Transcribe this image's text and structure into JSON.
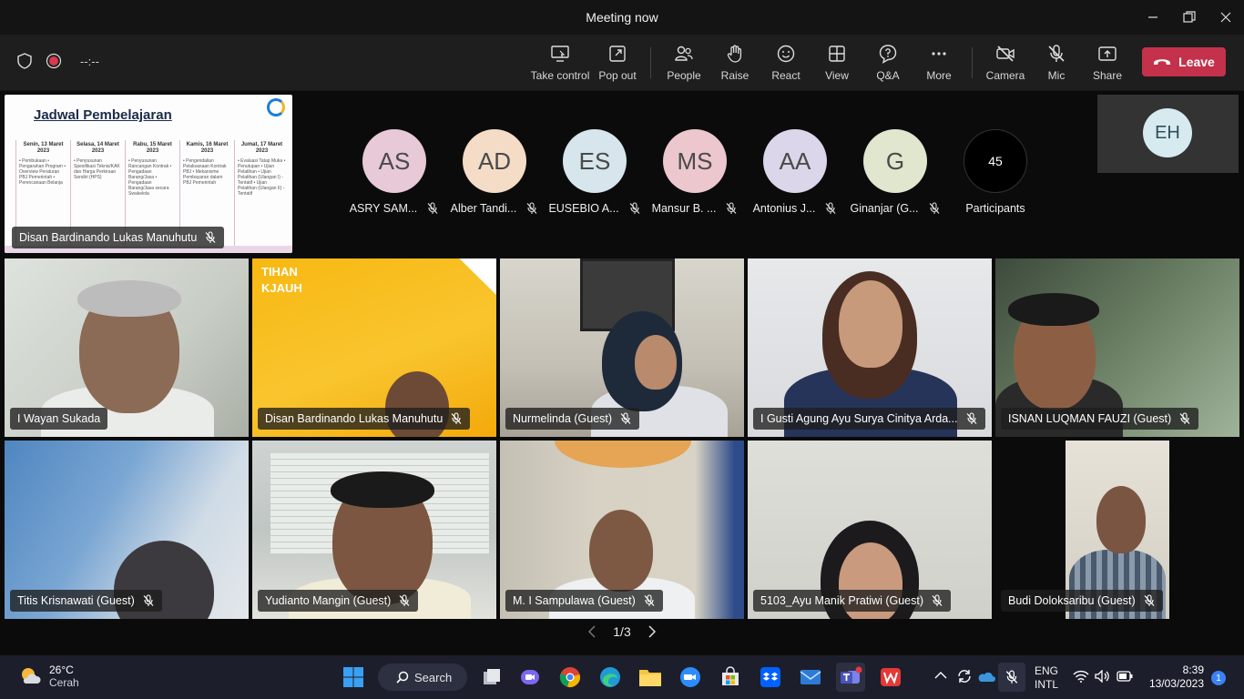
{
  "window": {
    "title": "Meeting now"
  },
  "toolbar": {
    "timer": "--:--",
    "buttons": {
      "take_control": "Take control",
      "pop_out": "Pop out",
      "people": "People",
      "raise": "Raise",
      "react": "React",
      "view": "View",
      "qa": "Q&A",
      "more": "More",
      "camera": "Camera",
      "mic": "Mic",
      "share": "Share"
    },
    "leave": "Leave",
    "leave_color": "#c4314b"
  },
  "shared_content": {
    "slide_title": "Jadwal Pembelajaran",
    "columns": [
      {
        "header": "Senin, 13 Maret 2023",
        "body": "• Pembukaan • Pengarahan Program • Overview Peraturan PBJ Pemerintah • Perencanaan Belanja"
      },
      {
        "header": "Selasa, 14 Maret 2023",
        "body": "• Penyusunan Spesifikasi Teknis/KAK dan Harga Perkiraan Sendiri (HPS)"
      },
      {
        "header": "Rabu, 15 Maret 2023",
        "body": "• Penyusunan Rancangan Kontrak • Pengadaan Barang/Jasa • Pengadaan Barang/Jasa secara Swakelola"
      },
      {
        "header": "Kamis, 16 Maret 2023",
        "body": "• Pengendalian Pelaksanaan Kontrak PBJ • Mekanisme Pembayaran dalam PBJ Pemerintah"
      },
      {
        "header": "Jumat, 17 Maret 2023",
        "body": "• Evaluasi Tatap Muka • Penutupan • Ujian Pelatihan • Ujian Pelatihan (Ulangan I) - Tentatif • Ujian Pelatihan (Ulangan II) - Tentatif"
      }
    ],
    "presenter": "Disan Bardinando Lukas Manuhutu"
  },
  "audio_participants": [
    {
      "initials": "AS",
      "name": "ASRY SAM...",
      "color": "#e8c9d8"
    },
    {
      "initials": "AD",
      "name": "Alber Tandi...",
      "color": "#f5dcc6"
    },
    {
      "initials": "ES",
      "name": "EUSEBIO A...",
      "color": "#d6e6ec"
    },
    {
      "initials": "MS",
      "name": "Mansur B. ...",
      "color": "#ecc7cd"
    },
    {
      "initials": "AA",
      "name": "Antonius J...",
      "color": "#dcd6ea"
    },
    {
      "initials": "G",
      "name": "Ginanjar (G...",
      "color": "#e1e6cf"
    }
  ],
  "participants": {
    "count": "45",
    "label": "Participants"
  },
  "self_view": {
    "initials": "EH"
  },
  "video_tiles": [
    {
      "name": "I Wayan Sukada",
      "muted": false
    },
    {
      "name": "Disan Bardinando Lukas Manuhutu",
      "muted": true
    },
    {
      "name": "Nurmelinda (Guest)",
      "muted": true
    },
    {
      "name": "I Gusti Agung Ayu Surya Cinitya Arda...",
      "muted": true
    },
    {
      "name": "ISNAN LUQMAN FAUZI (Guest)",
      "muted": true
    },
    {
      "name": "Titis Krisnawati (Guest)",
      "muted": true
    },
    {
      "name": "Yudianto Mangin (Guest)",
      "muted": true
    },
    {
      "name": "M. I Sampulawa (Guest)",
      "muted": true
    },
    {
      "name": "5103_Ayu Manik Pratiwi (Guest)",
      "muted": true
    },
    {
      "name": "Budi Doloksaribu (Guest)",
      "muted": true
    }
  ],
  "tile2_banner": "TIHAN\nKJAUH",
  "pagination": {
    "label": "1/3"
  },
  "taskbar": {
    "weather_temp": "26°C",
    "weather_desc": "Cerah",
    "search": "Search",
    "lang_top": "ENG",
    "lang_bottom": "INTL",
    "time": "8:39",
    "date": "13/03/2023",
    "notifications": "1"
  }
}
